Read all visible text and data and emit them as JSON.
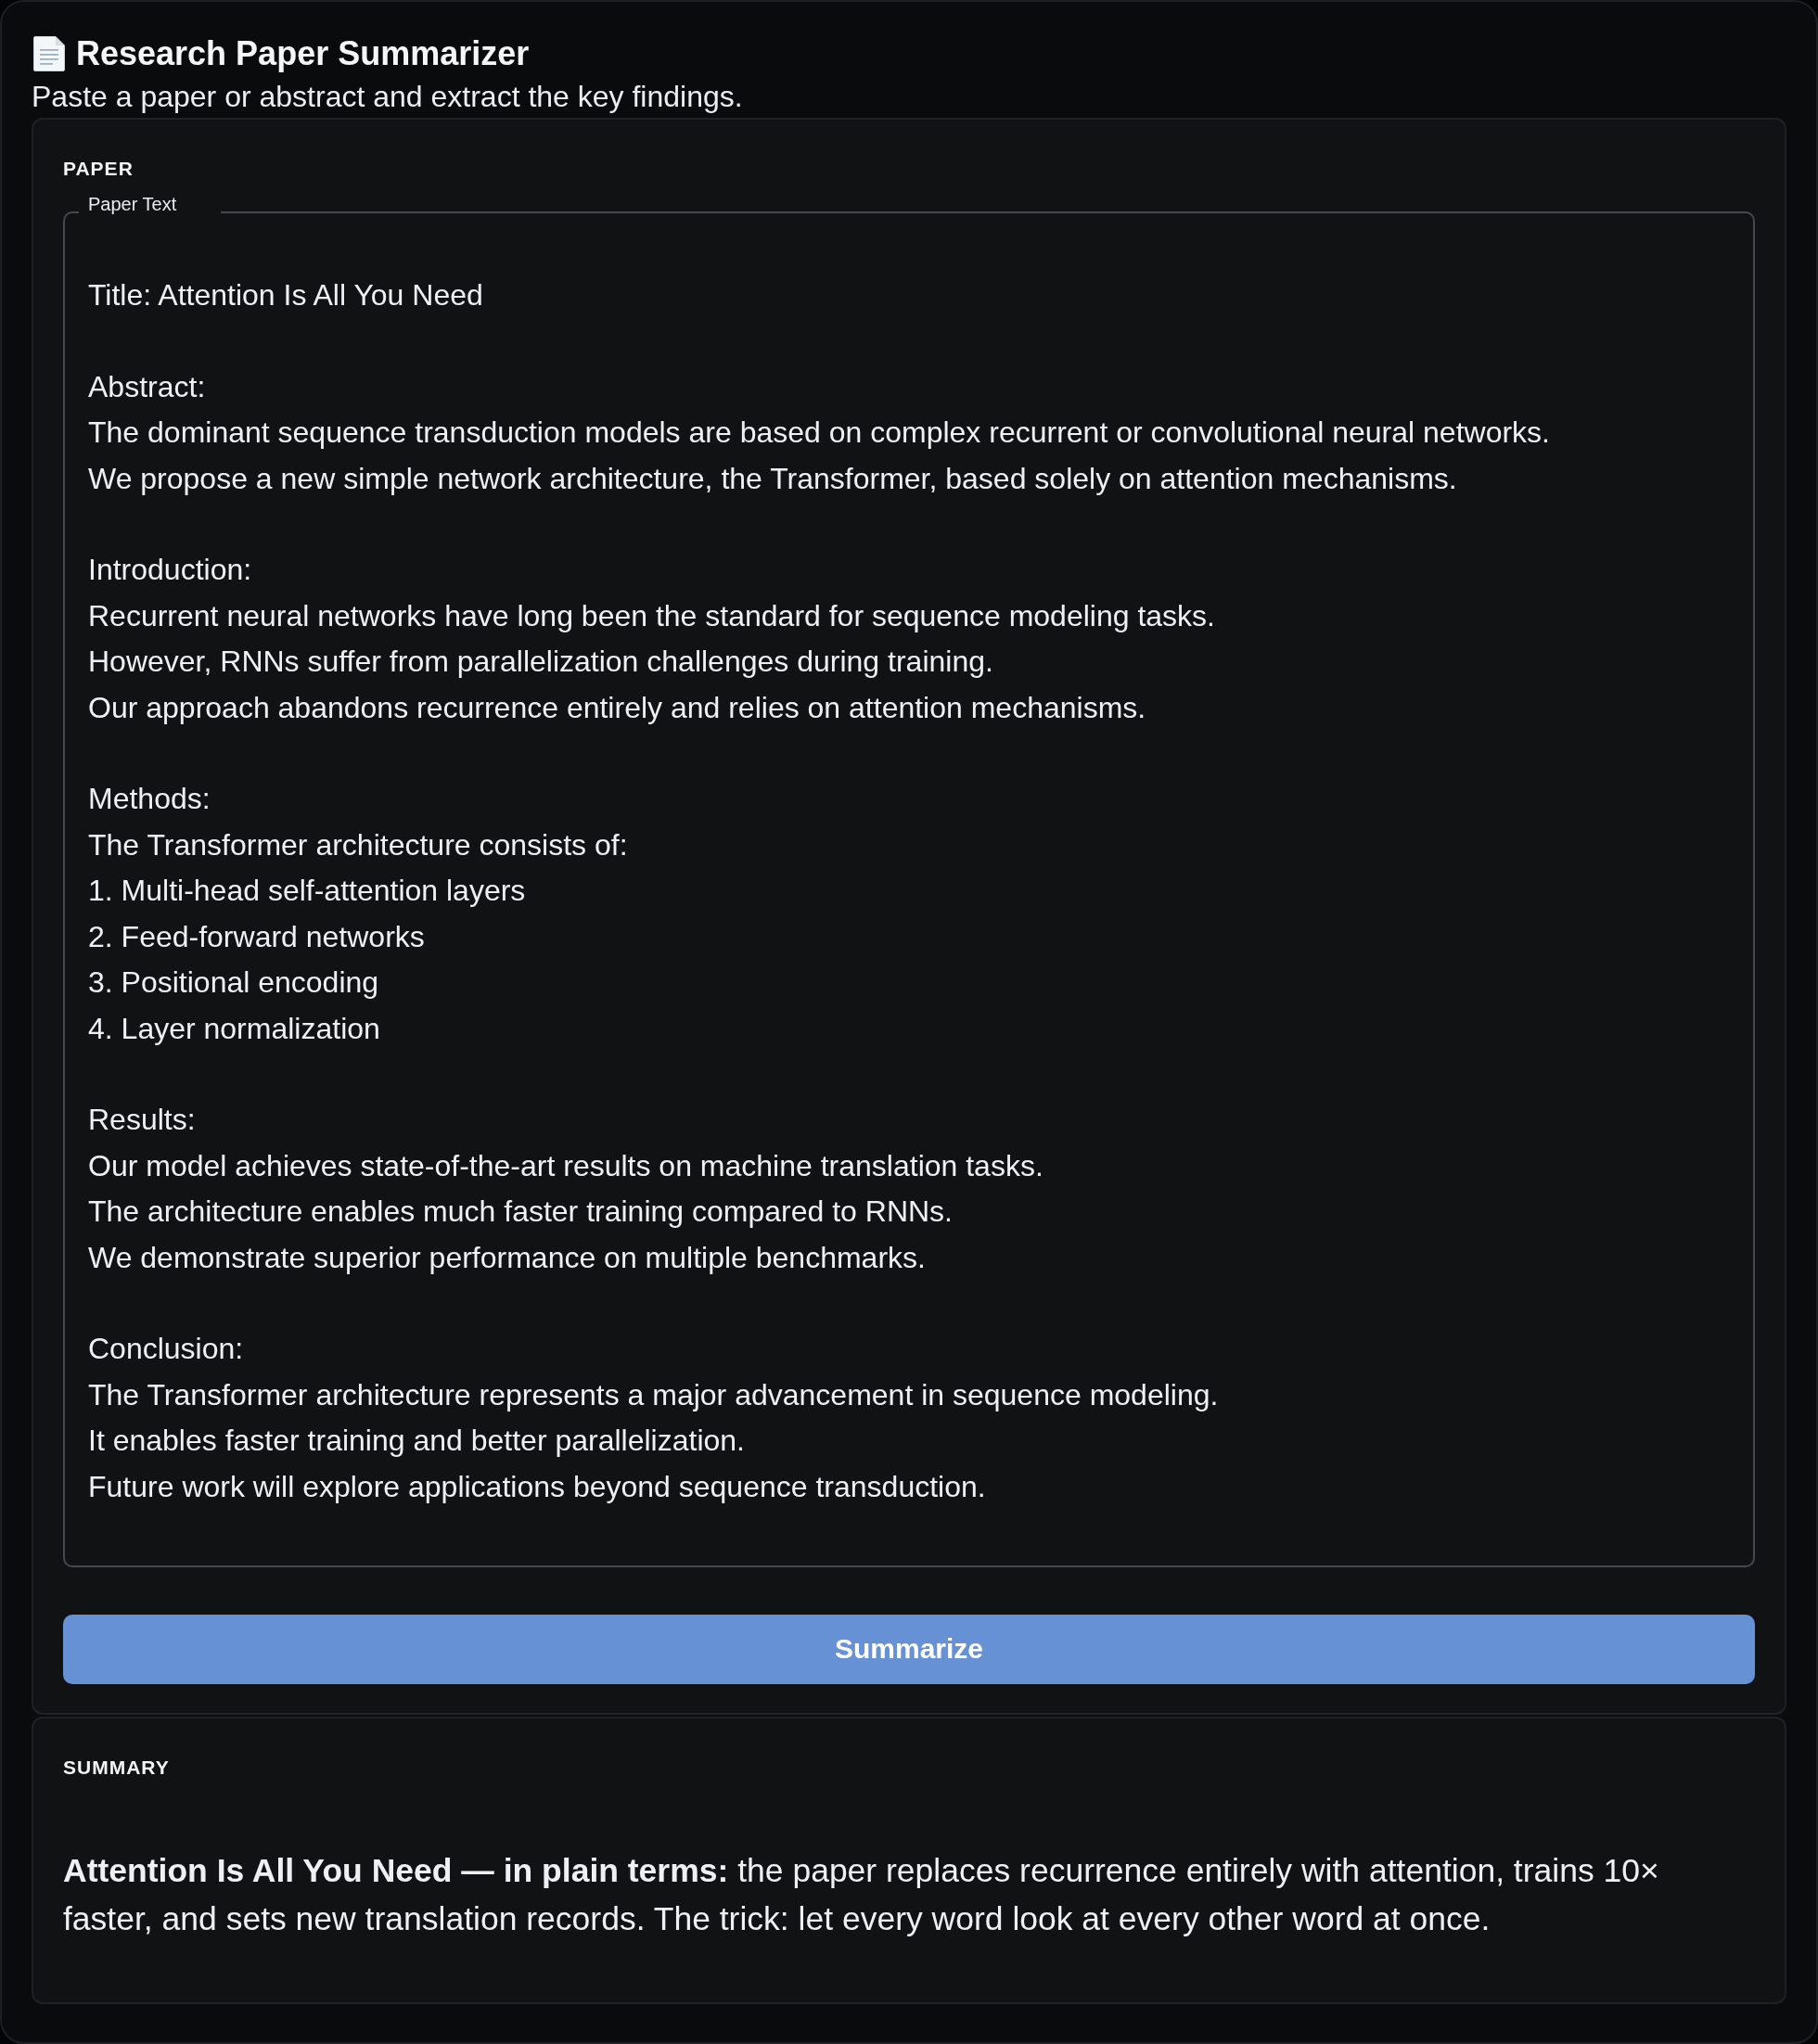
{
  "app": {
    "title": "Research Paper Summarizer",
    "subtitle": "Paste a paper or abstract and extract the key findings."
  },
  "paper_section": {
    "heading": "PAPER",
    "paper_text_field": {
      "label": "Paper Text",
      "value": "Title: Attention Is All You Need\n\nAbstract:\nThe dominant sequence transduction models are based on complex recurrent or convolutional neural networks.\nWe propose a new simple network architecture, the Transformer, based solely on attention mechanisms.\n\nIntroduction:\nRecurrent neural networks have long been the standard for sequence modeling tasks.\nHowever, RNNs suffer from parallelization challenges during training.\nOur approach abandons recurrence entirely and relies on attention mechanisms.\n\nMethods:\nThe Transformer architecture consists of:\n1. Multi-head self-attention layers\n2. Feed-forward networks\n3. Positional encoding\n4. Layer normalization\n\nResults:\nOur model achieves state-of-the-art results on machine translation tasks.\nThe architecture enables much faster training compared to RNNs.\nWe demonstrate superior performance on multiple benchmarks.\n\nConclusion:\nThe Transformer architecture represents a major advancement in sequence modeling.\nIt enables faster training and better parallelization.\nFuture work will explore applications beyond sequence transduction."
    },
    "summarize_button": "Summarize"
  },
  "summary_section": {
    "heading": "SUMMARY",
    "text": "**Attention Is All You Need — in plain terms:** the paper replaces recurrence entirely with attention, trains 10× faster, and sets new translation records. The trick: let every word look at every other word at once."
  }
}
